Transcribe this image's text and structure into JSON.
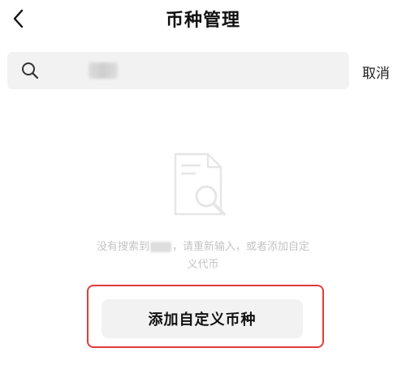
{
  "header": {
    "title": "币种管理",
    "back_icon": "chevron-left-icon"
  },
  "search": {
    "icon": "search-icon",
    "placeholder": "",
    "cancel_label": "取消"
  },
  "empty_state": {
    "icon": "document-search-icon",
    "message_part1": "没有搜索到",
    "message_part2": "，请重新输入，或者添加自定",
    "message_part3": "义代币"
  },
  "actions": {
    "add_custom_label": "添加自定义币种"
  },
  "colors": {
    "highlight": "#e23b3b",
    "muted_text": "#c4c4c4",
    "input_bg": "#f2f2f2"
  }
}
